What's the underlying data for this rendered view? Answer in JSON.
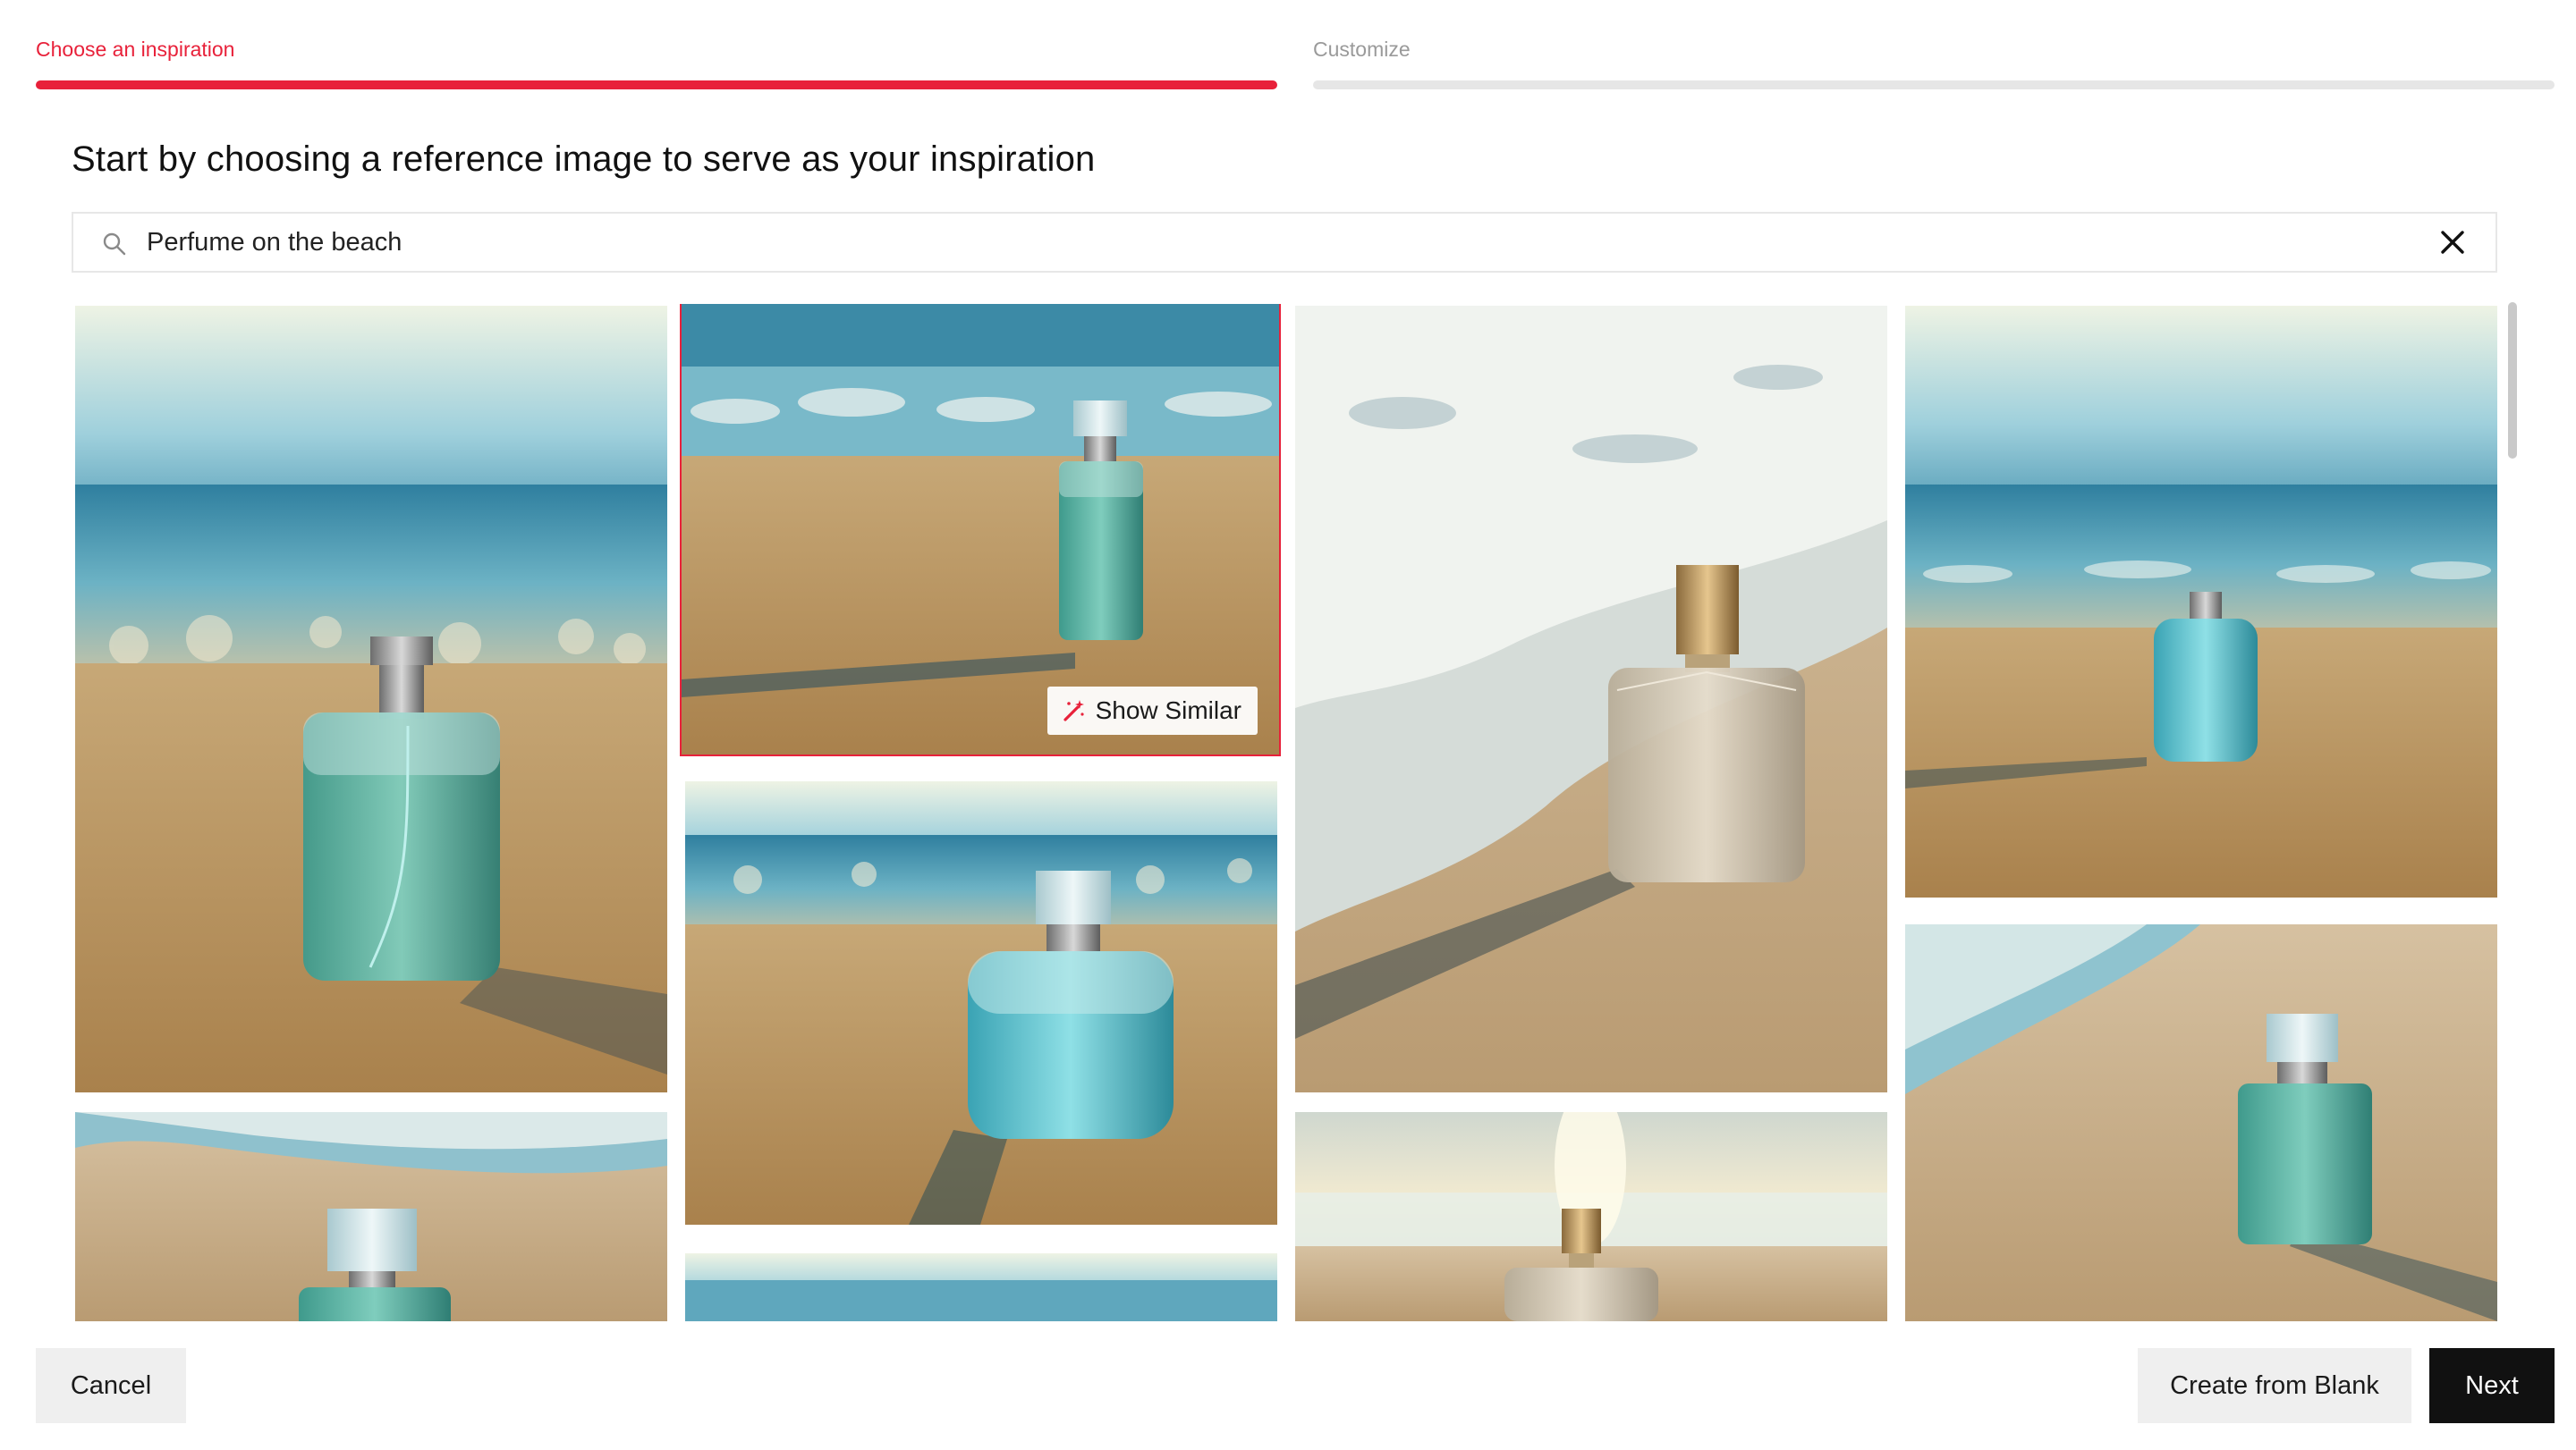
{
  "stepper": {
    "steps": [
      {
        "label": "Choose an inspiration",
        "state": "active"
      },
      {
        "label": "Customize",
        "state": "inactive"
      }
    ],
    "active_color": "#e8213a"
  },
  "heading": "Start by choosing a reference image to serve as your inspiration",
  "search": {
    "value": "Perfume on the beach",
    "icon": "search-icon",
    "clear_icon": "close-icon"
  },
  "gallery": {
    "selected_index": 1,
    "selected_overlay_label": "Show Similar",
    "images": [
      {
        "subject": "perfume bottle on beach sand, green liquid, chrome cap"
      },
      {
        "subject": "rectangular perfume bottle on sand, teal liquid, clear cap"
      },
      {
        "subject": "clear perfume bottle with gold cap near surf"
      },
      {
        "subject": "small round blue perfume bottle on sand"
      },
      {
        "subject": "teal perfume bottle with long shadow on sand"
      },
      {
        "subject": "teal perfume bottle on wet sand near waves"
      },
      {
        "subject": "perfume bottle on shoreline"
      },
      {
        "subject": "beach horizon"
      },
      {
        "subject": "perfume bottle with gold cap at sunset shoreline"
      }
    ]
  },
  "footer": {
    "cancel_label": "Cancel",
    "create_blank_label": "Create from Blank",
    "next_label": "Next"
  }
}
